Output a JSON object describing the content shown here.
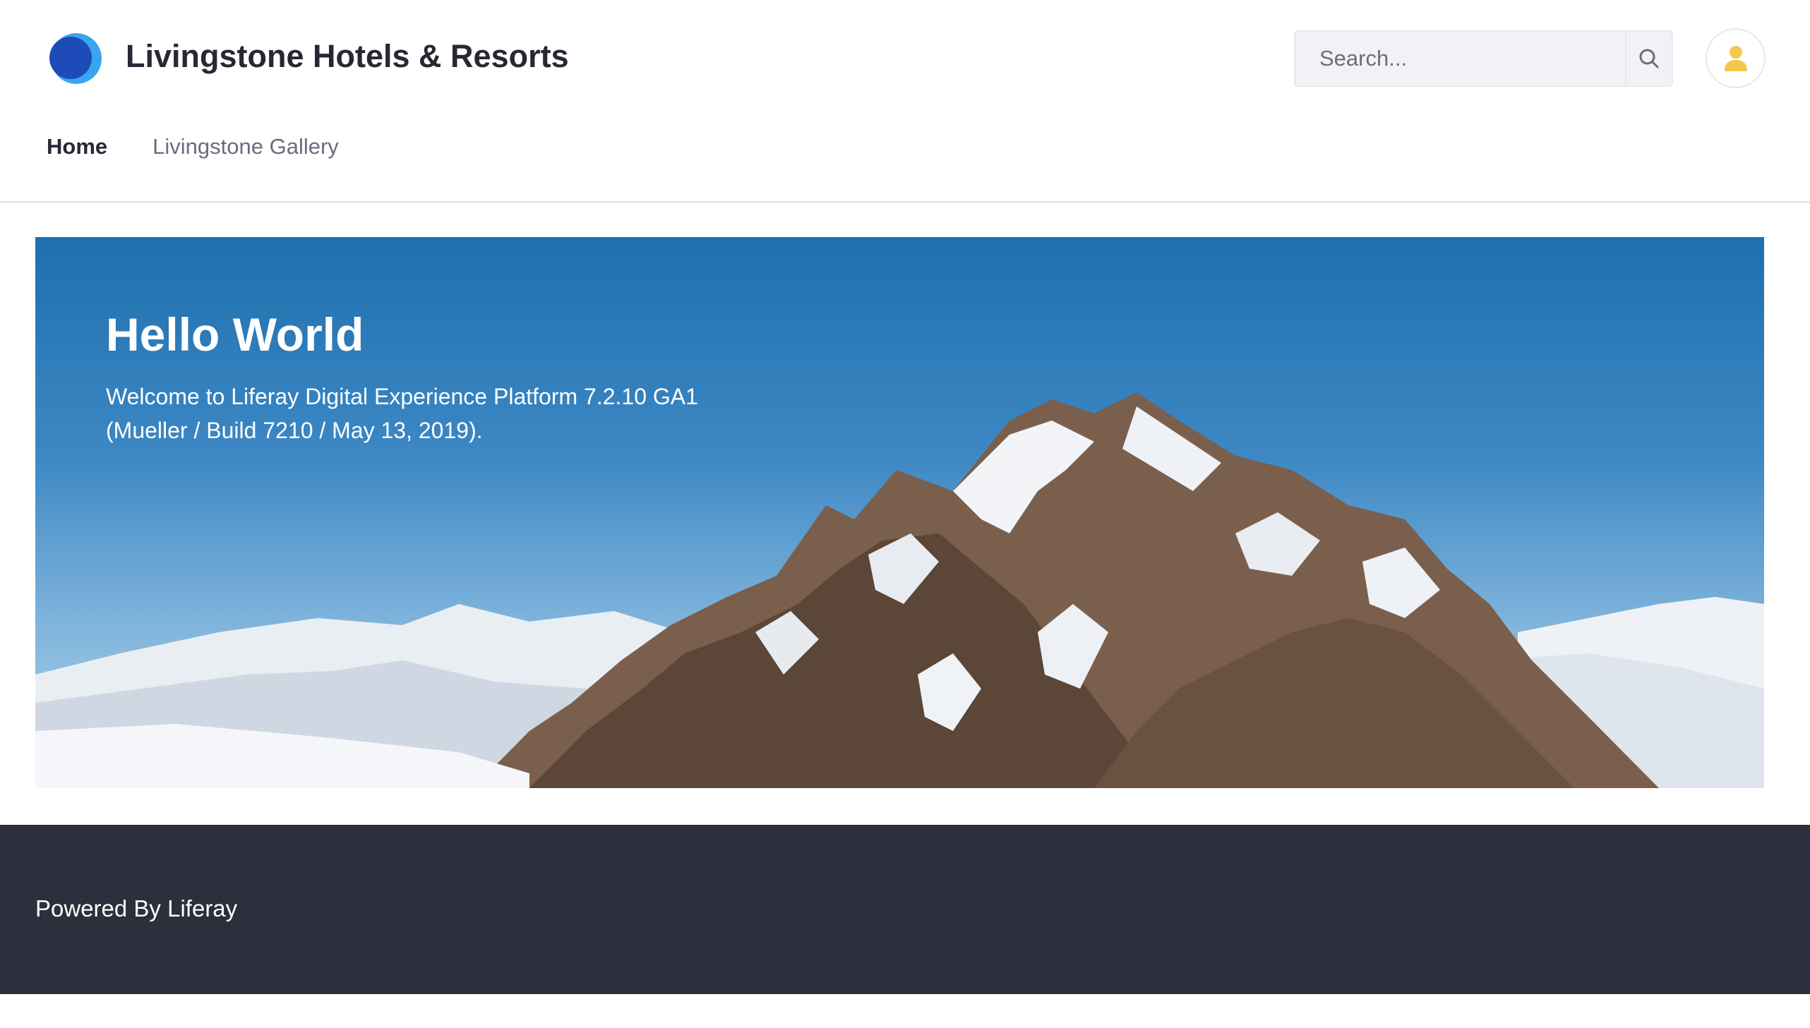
{
  "header": {
    "site_title": "Livingstone Hotels & Resorts",
    "logo_icon": "liferay-logo-icon"
  },
  "search": {
    "placeholder": "Search...",
    "icon": "search-icon"
  },
  "user": {
    "icon": "user-icon",
    "color": "#f2c94c"
  },
  "nav": {
    "items": [
      {
        "label": "Home",
        "active": true
      },
      {
        "label": "Livingstone Gallery",
        "active": false
      }
    ]
  },
  "banner": {
    "title": "Hello World",
    "text": "Welcome to Liferay Digital Experience Platform 7.2.10 GA1 (Mueller / Build 7210 / May 13, 2019)."
  },
  "footer": {
    "powered_by": "Powered By",
    "brand": "Liferay",
    "background": "#2e2f3c"
  },
  "colors": {
    "accent": "#0b5fff",
    "text": "#272833",
    "muted": "#6b6c7e"
  }
}
